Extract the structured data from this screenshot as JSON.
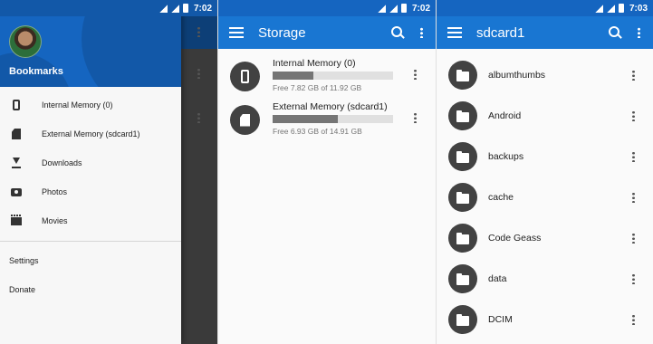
{
  "status": {
    "time_left": "7:02",
    "time_middle": "7:02",
    "time_right": "7:03"
  },
  "drawer": {
    "title": "Bookmarks",
    "items": [
      {
        "label": "Internal Memory (0)",
        "icon": "phone-icon"
      },
      {
        "label": "External Memory (sdcard1)",
        "icon": "sd-card-icon"
      },
      {
        "label": "Downloads",
        "icon": "download-icon"
      },
      {
        "label": "Photos",
        "icon": "camera-icon"
      },
      {
        "label": "Movies",
        "icon": "movie-icon"
      }
    ],
    "secondary": [
      {
        "label": "Settings"
      },
      {
        "label": "Donate"
      }
    ]
  },
  "storage_screen": {
    "title": "Storage",
    "items": [
      {
        "name": "Internal Memory (0)",
        "free": "Free 7.82 GB of 11.92 GB",
        "used_fraction": 0.34,
        "icon": "phone-icon"
      },
      {
        "name": "External Memory (sdcard1)",
        "free": "Free 6.93 GB of 14.91 GB",
        "used_fraction": 0.54,
        "icon": "sd-card-icon"
      }
    ]
  },
  "folder_screen": {
    "title": "sdcard1",
    "folders": [
      "albumthumbs",
      "Android",
      "backups",
      "cache",
      "Code Geass",
      "data",
      "DCIM"
    ]
  },
  "colors": {
    "primary": "#1976d2",
    "primary_dark": "#1565c0",
    "icon_bg": "#424242"
  }
}
